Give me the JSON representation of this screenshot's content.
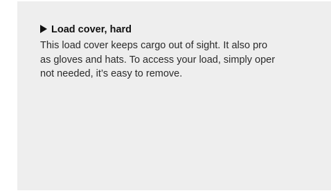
{
  "section": {
    "heading": "Load cover, hard",
    "heading_icon": "play-triangle-icon",
    "body_lines": [
      "This load cover keeps cargo out of sight. It also pro",
      "as gloves and hats. To access your load, simply oper",
      "not needed, it’s easy to remove."
    ]
  },
  "colors": {
    "panel_background": "#eeeeee",
    "page_background": "#ffffff",
    "text": "#2a2a2a",
    "heading": "#111111"
  }
}
